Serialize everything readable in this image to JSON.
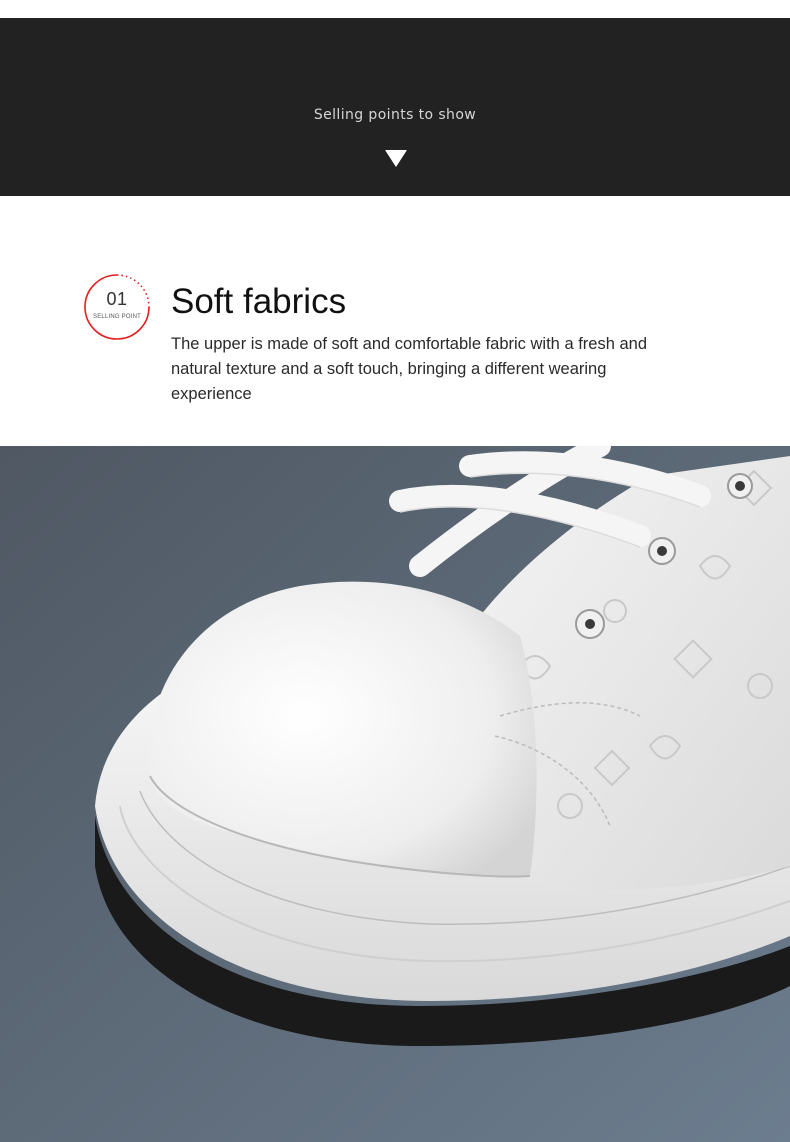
{
  "banner": {
    "text": "Selling points to show",
    "arrow_icon": "down-triangle-icon",
    "background": "#222222"
  },
  "feature": {
    "number": "01",
    "number_sublabel": "SELLING POINT",
    "badge_accent": "#e02020",
    "title": "Soft fabrics",
    "description": "The upper is made of soft and comfortable fabric with a fresh and natural texture and a soft touch, bringing a different wearing experience"
  },
  "photo": {
    "subject": "white-sneaker-toe-closeup"
  }
}
